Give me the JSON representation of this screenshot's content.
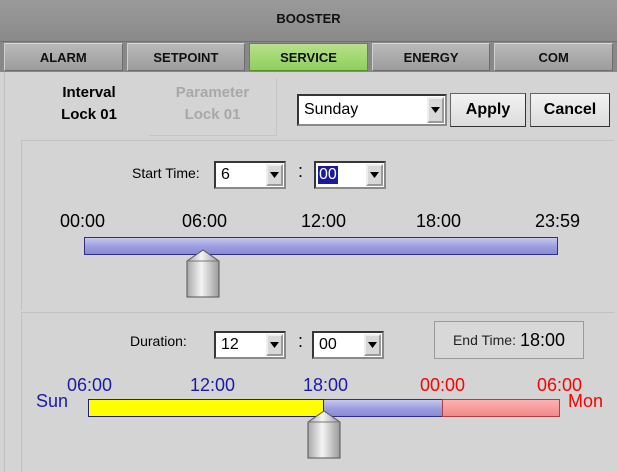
{
  "header": {
    "title": "BOOSTER"
  },
  "nav": {
    "tabs": [
      {
        "label": "ALARM",
        "active": false
      },
      {
        "label": "SETPOINT",
        "active": false
      },
      {
        "label": "SERVICE",
        "active": true
      },
      {
        "label": "ENERGY",
        "active": false
      },
      {
        "label": "COM",
        "active": false
      }
    ]
  },
  "subtabs": {
    "interval": {
      "line1": "Interval",
      "line2": "Lock 01"
    },
    "parameter": {
      "line1": "Parameter",
      "line2": "Lock 01"
    }
  },
  "day_select": {
    "value": "Sunday"
  },
  "buttons": {
    "apply": "Apply",
    "cancel": "Cancel"
  },
  "start_time": {
    "label": "Start Time:",
    "hour": "6",
    "separator": ":",
    "minute": "00"
  },
  "timeline_day": {
    "ticks": [
      "00:00",
      "06:00",
      "12:00",
      "18:00",
      "23:59"
    ],
    "pointer_fraction": 0.25
  },
  "duration": {
    "label": "Duration:",
    "hours": "12",
    "separator": ":",
    "minutes": "00"
  },
  "end_time": {
    "label": "End Time:",
    "value": "18:00"
  },
  "timeline_week": {
    "ticks": [
      {
        "label": "06:00",
        "color": "#1a1aa8"
      },
      {
        "label": "12:00",
        "color": "#1a1aa8"
      },
      {
        "label": "18:00",
        "color": "#1a1aa8"
      },
      {
        "label": "00:00",
        "color": "#ff0000"
      },
      {
        "label": "06:00",
        "color": "#ff0000"
      }
    ],
    "left_label": "Sun",
    "left_color": "#1a1aa8",
    "right_label": "Mon",
    "right_color": "#ff0000",
    "yellow_fraction": 0.5,
    "red_fraction_start": 0.75,
    "pointer_fraction": 0.5
  },
  "colors": {
    "active_tab": "#9ad46a",
    "timeline_blue": "#9c9ce0",
    "interval_yellow": "#ffff00",
    "next_day_red": "#f08a8a"
  }
}
